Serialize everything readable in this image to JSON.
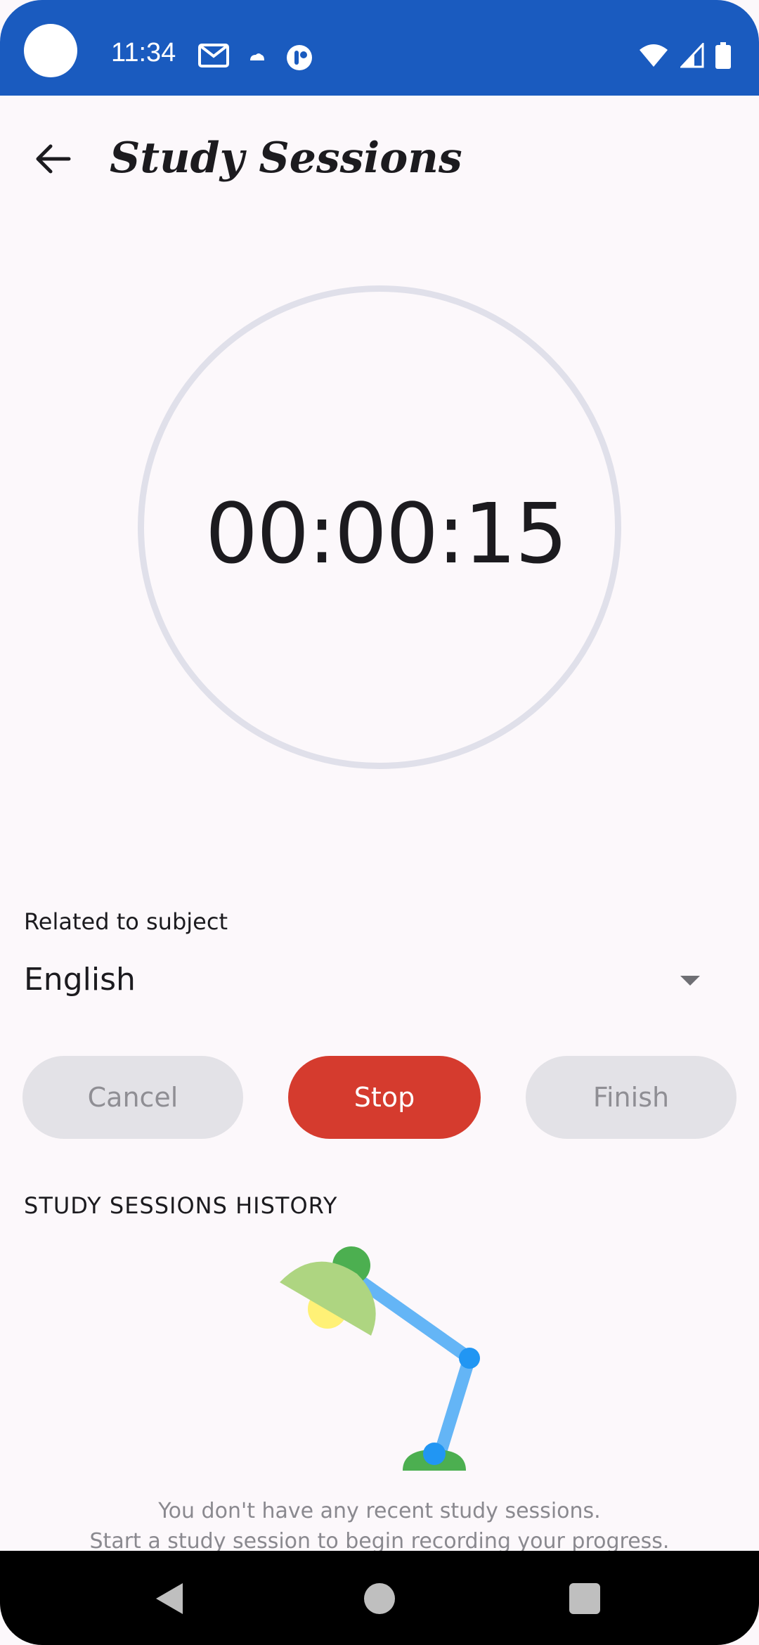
{
  "status_bar": {
    "time": "11:34",
    "icons_left": [
      "gmail-icon",
      "cloud-icon",
      "app-badge-icon"
    ],
    "icons_right": [
      "wifi-icon",
      "signal-icon",
      "battery-icon"
    ],
    "color": "#1a5bbf"
  },
  "app_bar": {
    "title": "Study Sessions",
    "back_icon": "arrow-back-icon"
  },
  "timer": {
    "display": "00:00:15"
  },
  "subject": {
    "label": "Related to subject",
    "value": "English"
  },
  "actions": {
    "cancel_label": "Cancel",
    "stop_label": "Stop",
    "finish_label": "Finish",
    "stop_color": "#d53b2e"
  },
  "history": {
    "title": "STUDY SESSIONS HISTORY",
    "empty_line_1": "You don't have any recent study sessions.",
    "empty_line_2": "Start a study session to begin recording your progress."
  },
  "nav_bar": {
    "back_icon": "nav-back-icon",
    "home_icon": "nav-home-icon",
    "recents_icon": "nav-recents-icon"
  }
}
